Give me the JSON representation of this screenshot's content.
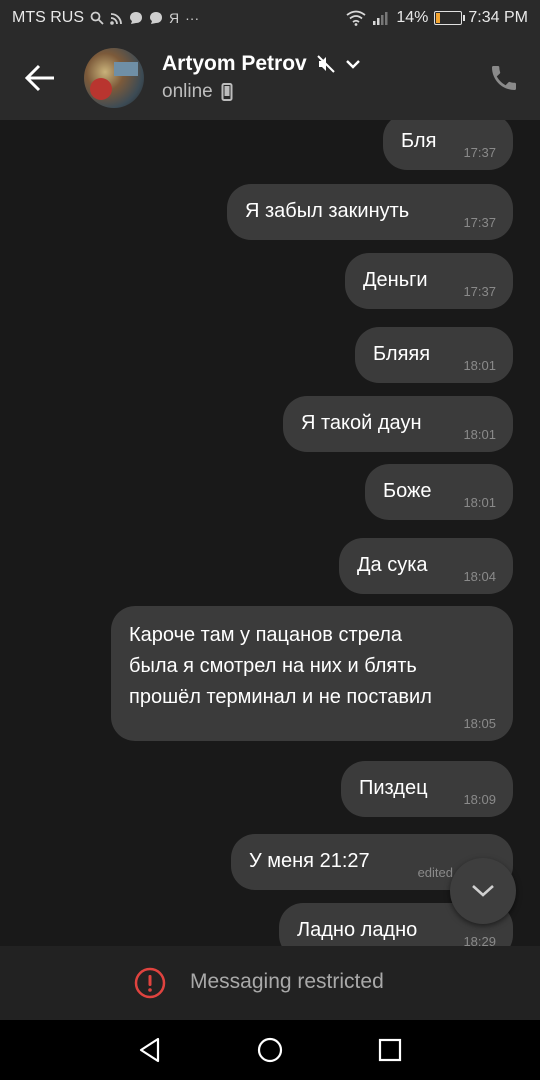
{
  "status_bar": {
    "carrier": "MTS RUS",
    "notif_letter": "Я",
    "more": "···",
    "battery_percent": "14%",
    "battery_level": 0.14,
    "time": "7:34 PM"
  },
  "header": {
    "contact_name": "Artyom Petrov",
    "status": "online",
    "icons": {
      "back": "back-arrow-icon",
      "mute": "muted-speaker-icon",
      "chevron": "chevron-down-icon",
      "device": "mobile-device-icon",
      "call": "phone-icon"
    }
  },
  "messages": [
    {
      "text": "Бля",
      "time": "17:37"
    },
    {
      "text": "Я забыл закинуть",
      "time": "17:37"
    },
    {
      "text": "Деньги",
      "time": "17:37"
    },
    {
      "text": "Бляяя",
      "time": "18:01"
    },
    {
      "text": "Я такой даун",
      "time": "18:01"
    },
    {
      "text": "Боже",
      "time": "18:01"
    },
    {
      "text": "Да сука",
      "time": "18:04"
    },
    {
      "text": "Кароче там у пацанов стрела\nбыла я смотрел на них и блять\nпрошёл терминал и не поставил",
      "time": "18:05"
    },
    {
      "text": "Пиздец",
      "time": "18:09"
    },
    {
      "text": "У меня 21:27",
      "time": "edited"
    },
    {
      "text": "Ладно ладно",
      "time": "18:29"
    }
  ],
  "restricted": {
    "label": "Messaging restricted",
    "accent": "#e0433f"
  },
  "colors": {
    "background": "#191919",
    "bubble": "#3b3b3b",
    "header": "#2a2a2a",
    "battery": "#f3a532"
  }
}
